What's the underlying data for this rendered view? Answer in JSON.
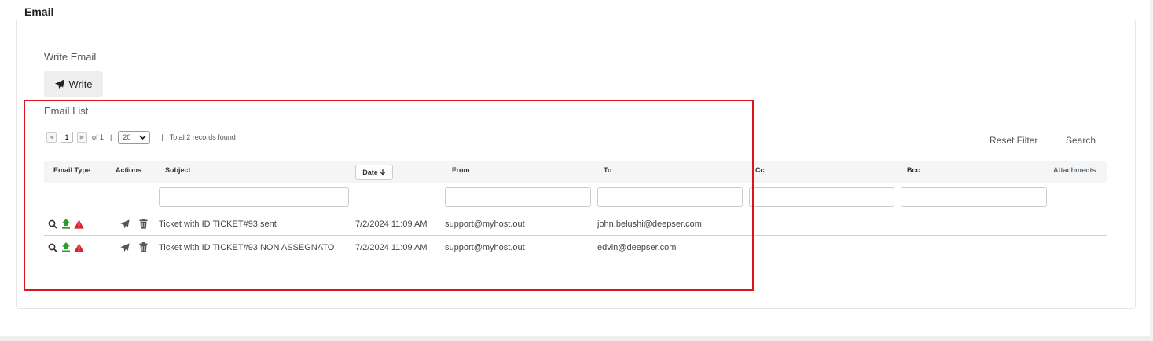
{
  "section": {
    "title": "Email"
  },
  "write_email": {
    "label": "Write Email",
    "button_label": "Write"
  },
  "email_list": {
    "label": "Email List",
    "pager": {
      "current_page": "1",
      "of_text": "of 1",
      "separator": "|",
      "page_size": "20",
      "total_text": "Total 2 records found"
    },
    "reset_filter_label": "Reset Filter",
    "search_label": "Search",
    "columns": {
      "email_type": "Email Type",
      "actions": "Actions",
      "subject": "Subject",
      "date": "Date",
      "from": "From",
      "to": "To",
      "cc": "Cc",
      "bcc": "Bcc",
      "attachments": "Attachments"
    },
    "rows": [
      {
        "subject": "Ticket with ID TICKET#93 sent",
        "date": "7/2/2024 11:09 AM",
        "from": "support@myhost.out",
        "to": "john.belushi@deepser.com",
        "cc": "",
        "bcc": ""
      },
      {
        "subject": "Ticket with ID TICKET#93 NON ASSEGNATO",
        "date": "7/2/2024 11:09 AM",
        "from": "support@myhost.out",
        "to": "edvin@deepser.com",
        "cc": "",
        "bcc": ""
      }
    ]
  },
  "icons": {
    "view": "magnifier-icon",
    "outgoing": "upload-arrow-icon",
    "alert": "warning-triangle-icon",
    "forward": "paper-plane-icon",
    "delete": "trash-icon"
  },
  "colors": {
    "highlight_border": "#d9141c",
    "outgoing_icon": "#2e9b2e",
    "alert_icon": "#d9232e",
    "header_band": "#f5f5f5",
    "button_bg": "#eeeeee"
  }
}
